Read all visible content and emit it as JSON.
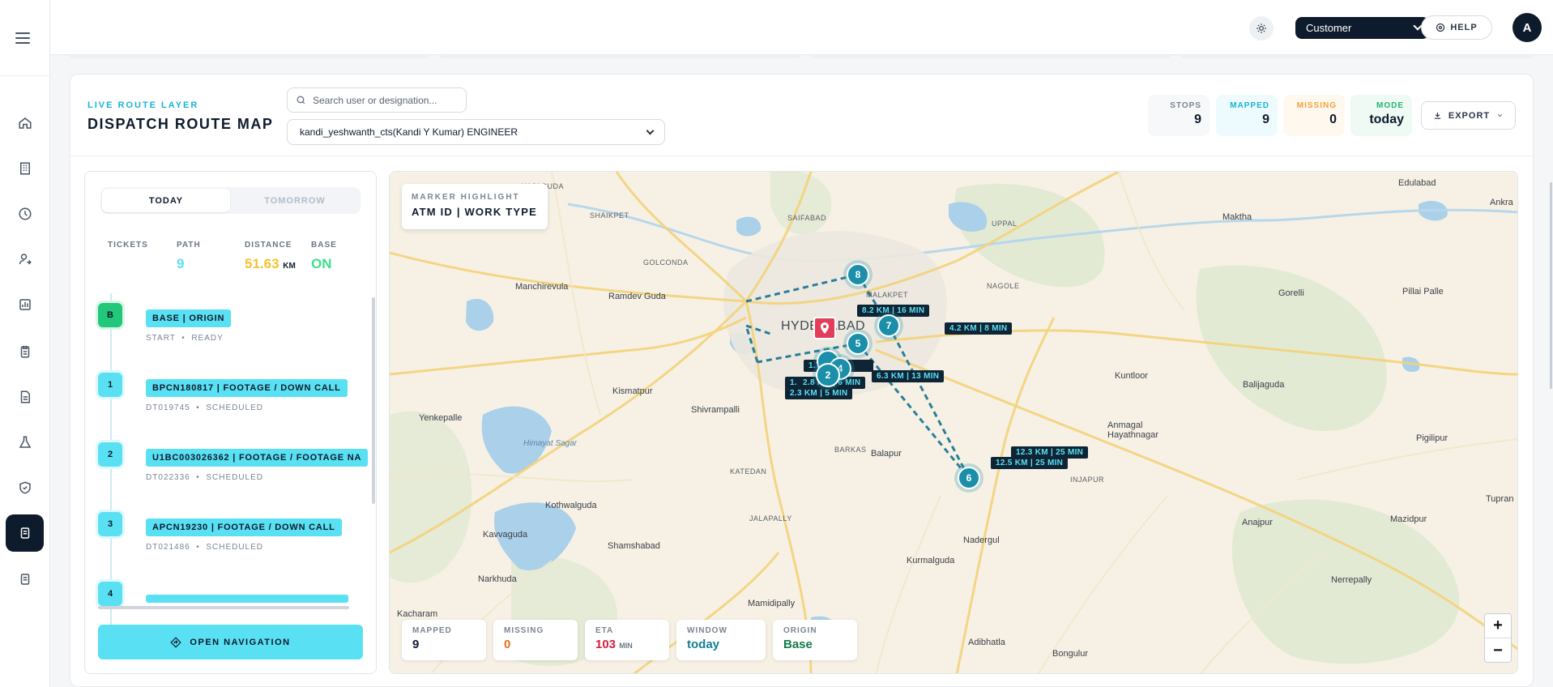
{
  "topbar": {
    "theme_icon": "sun-icon",
    "role": "Customer",
    "help_label": "HELP",
    "avatar_initial": "A"
  },
  "sidebar": {
    "items": [
      {
        "icon": "home-icon"
      },
      {
        "icon": "building-icon"
      },
      {
        "icon": "clock-icon"
      },
      {
        "icon": "user-route-icon"
      },
      {
        "icon": "chart-icon"
      },
      {
        "icon": "clipboard-icon"
      },
      {
        "icon": "document-icon"
      },
      {
        "icon": "flask-icon"
      },
      {
        "icon": "shield-icon"
      },
      {
        "icon": "map-document-icon",
        "active": true
      },
      {
        "icon": "list-document-icon"
      }
    ]
  },
  "header": {
    "eyebrow": "LIVE ROUTE LAYER",
    "title": "DISPATCH ROUTE MAP",
    "search_placeholder": "Search user or designation...",
    "selected_user": "kandi_yeshwanth_cts(Kandi Y Kumar) ENGINEER",
    "stats": [
      {
        "label": "STOPS",
        "value": "9",
        "color": "#7b8593",
        "value_color": "#0e1b2c",
        "bg": "#f6f8fa"
      },
      {
        "label": "MAPPED",
        "value": "9",
        "color": "#19b3d6",
        "value_color": "#0e1b2c",
        "bg": "#eefbfe"
      },
      {
        "label": "MISSING",
        "value": "0",
        "color": "#f0a23b",
        "value_color": "#0e1b2c",
        "bg": "#fff8ee"
      },
      {
        "label": "MODE",
        "value": "today",
        "color": "#22b573",
        "value_color": "#0e1b2c",
        "bg": "#eefaf3"
      }
    ],
    "export_label": "EXPORT"
  },
  "panel": {
    "tabs": [
      {
        "label": "TODAY",
        "active": true
      },
      {
        "label": "TOMORROW",
        "active": false
      }
    ],
    "kpis": {
      "tickets": {
        "label": "TICKETS",
        "value": ""
      },
      "path": {
        "label": "PATH",
        "value": "9",
        "color": "#5ae0f3"
      },
      "distance": {
        "label": "DISTANCE",
        "value": "51.63",
        "unit": "KM",
        "color": "#f5c232"
      },
      "base": {
        "label": "BASE",
        "value": "ON",
        "color": "#3ee08a"
      }
    },
    "stops": [
      {
        "badge": "B",
        "badge_color": "#22c77a",
        "title": "BASE | ORIGIN",
        "meta1": "START",
        "meta2": "READY"
      },
      {
        "badge": "1",
        "badge_color": "#5ae0f3",
        "title": "BPCN180817 | FOOTAGE / DOWN CALL",
        "meta1": "DT019745",
        "meta2": "SCHEDULED"
      },
      {
        "badge": "2",
        "badge_color": "#5ae0f3",
        "title": "U1BC003026362 | FOOTAGE / FOOTAGE NA",
        "meta1": "DT022336",
        "meta2": "SCHEDULED"
      },
      {
        "badge": "3",
        "badge_color": "#5ae0f3",
        "title": "APCN19230 | FOOTAGE / DOWN CALL",
        "meta1": "DT021486",
        "meta2": "SCHEDULED"
      },
      {
        "badge": "4",
        "badge_color": "#5ae0f3",
        "title": "",
        "meta1": "",
        "meta2": ""
      }
    ],
    "open_nav_label": "OPEN NAVIGATION"
  },
  "map": {
    "highlight_eyebrow": "MARKER HIGHLIGHT",
    "highlight_title": "ATM ID | WORK TYPE",
    "places": {
      "hajaguda": "HAJAGUDA",
      "shaikpet": "SHAIKPET",
      "saifabad": "SAIFABAD",
      "uppal": "UPPAL",
      "edulabad": "Edulabad",
      "maktha": "Maktha",
      "ankra": "Ankra",
      "golconda": "GOLCONDA",
      "manchirevula": "Manchirevula",
      "ramdev_guda": "Ramdev Guda",
      "malakpet": "MALAKPET",
      "nagole": "NAGOLE",
      "gorelli": "Gorelli",
      "pillai_palle": "Pillai Palle",
      "hyderabad": "HYDERABAD",
      "kismatpur": "Kismatpur",
      "shivrampalli": "Shivrampalli",
      "kuntloor": "Kuntloor",
      "balijaguda": "Balijaguda",
      "yenkepalle": "Yenkepalle",
      "himayat_sagar": "Himayat Sagar",
      "anmagal": "Anmagal\nHayathnagar",
      "pigilipur": "Pigilipur",
      "barkas": "BARKAS",
      "balapur": "Balapur",
      "katedan": "KATEDAN",
      "injapur": "INJAPUR",
      "kothwalguda": "Kothwalguda",
      "jalapally": "JALAPALLY",
      "mazidpur": "Mazidpur",
      "tupran": "Tupran",
      "kavvaguda": "Kavvaguda",
      "nadergul": "Nadergul",
      "anajpur": "Anajpur",
      "narkhuda": "Narkhuda",
      "shamshabad": "Shamshabad",
      "kurmalguda": "Kurmalguda",
      "nerrepally": "Nerrepally",
      "kacharam": "Kacharam",
      "mamidipally": "Mamidipally",
      "adibhatla": "Adibhatla",
      "bongulur": "Bongulur"
    },
    "segments": [
      "8.2 KM | 16 MIN",
      "4.2 KM | 8 MIN",
      "1.7 KM",
      "6.3 KM | 13 MIN",
      "1.",
      "2.8 KM | 6 MIN",
      "2.3 KM | 5 MIN",
      "12.3 KM | 25 MIN",
      "12.5 KM | 25 MIN"
    ],
    "markers": [
      "8",
      "7",
      "4",
      "5",
      "2",
      "6"
    ],
    "footer_stats": [
      {
        "label": "MAPPED",
        "value": "9",
        "unit": "",
        "color": "#0e1b2c"
      },
      {
        "label": "MISSING",
        "value": "0",
        "unit": "",
        "color": "#e0701f"
      },
      {
        "label": "ETA",
        "value": "103",
        "unit": "MIN",
        "color": "#d4213d"
      },
      {
        "label": "WINDOW",
        "value": "today",
        "unit": "",
        "color": "#137f97"
      },
      {
        "label": "ORIGIN",
        "value": "Base",
        "unit": "",
        "color": "#137a4a"
      }
    ],
    "zoom_in": "+",
    "zoom_out": "−"
  }
}
